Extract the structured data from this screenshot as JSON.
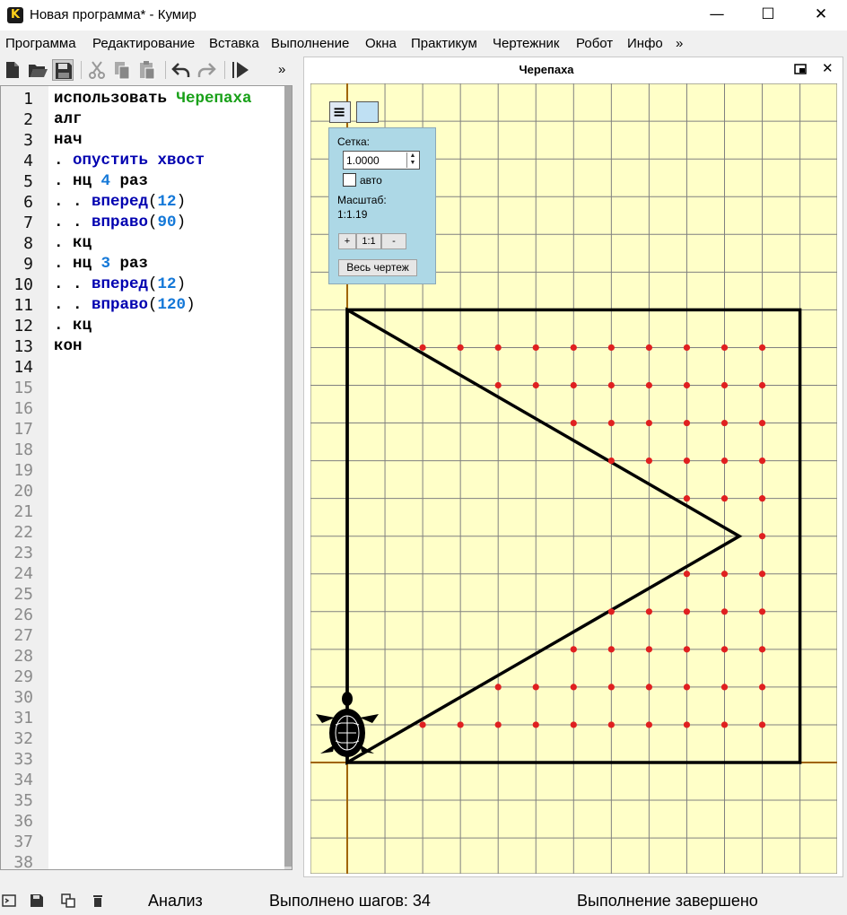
{
  "window": {
    "title": "Новая программа* - Кумир",
    "icon_letter": "K",
    "minimize": "—",
    "maximize": "☐",
    "close": "✕"
  },
  "menu": [
    "Программа",
    "Редактирование",
    "Вставка",
    "Выполнение",
    "Окна",
    "Практикум",
    "Чертежник",
    "Робот",
    "Инфо",
    "»"
  ],
  "toolbar": {
    "overflow": "»",
    "icons": [
      "new-file-icon",
      "open-folder-icon",
      "save-icon",
      "cut-icon",
      "copy-icon",
      "paste-icon",
      "undo-icon",
      "redo-icon",
      "run-icon"
    ]
  },
  "editor": {
    "line_numbers": [
      "1",
      "2",
      "3",
      "4",
      "5",
      "6",
      "7",
      "8",
      "9",
      "10",
      "11",
      "12",
      "13",
      "14",
      "15",
      "16",
      "17",
      "18",
      "19",
      "20",
      "21",
      "22",
      "23",
      "24",
      "25",
      "26",
      "27",
      "28",
      "29",
      "30",
      "31",
      "32",
      "33",
      "34",
      "35",
      "36",
      "37",
      "38"
    ],
    "lines": [
      [
        {
          "t": "использовать ",
          "c": "k"
        },
        {
          "t": "Черепаха",
          "c": "g"
        }
      ],
      [
        {
          "t": "алг",
          "c": "k"
        }
      ],
      [
        {
          "t": "нач",
          "c": "k"
        }
      ],
      [
        {
          "t": ". ",
          "c": "k"
        },
        {
          "t": "опустить хвост",
          "c": "b"
        }
      ],
      [
        {
          "t": ". нц ",
          "c": "k"
        },
        {
          "t": "4",
          "c": "n"
        },
        {
          "t": " раз",
          "c": "k"
        }
      ],
      [
        {
          "t": ". . ",
          "c": "k"
        },
        {
          "t": "вперед",
          "c": "b"
        },
        {
          "t": "(",
          "c": "p"
        },
        {
          "t": "12",
          "c": "n"
        },
        {
          "t": ")",
          "c": "p"
        }
      ],
      [
        {
          "t": ". . ",
          "c": "k"
        },
        {
          "t": "вправо",
          "c": "b"
        },
        {
          "t": "(",
          "c": "p"
        },
        {
          "t": "90",
          "c": "n"
        },
        {
          "t": ")",
          "c": "p"
        }
      ],
      [
        {
          "t": ". кц",
          "c": "k"
        }
      ],
      [
        {
          "t": ". нц ",
          "c": "k"
        },
        {
          "t": "3",
          "c": "n"
        },
        {
          "t": " раз",
          "c": "k"
        }
      ],
      [
        {
          "t": ". . ",
          "c": "k"
        },
        {
          "t": "вперед",
          "c": "b"
        },
        {
          "t": "(",
          "c": "p"
        },
        {
          "t": "12",
          "c": "n"
        },
        {
          "t": ")",
          "c": "p"
        }
      ],
      [
        {
          "t": ". . ",
          "c": "k"
        },
        {
          "t": "вправо",
          "c": "b"
        },
        {
          "t": "(",
          "c": "p"
        },
        {
          "t": "120",
          "c": "n"
        },
        {
          "t": ")",
          "c": "p"
        }
      ],
      [
        {
          "t": ". кц",
          "c": "k"
        }
      ],
      [
        {
          "t": "кон",
          "c": "k"
        }
      ]
    ]
  },
  "turtle_panel": {
    "title": "Черепаха",
    "close": "✕",
    "settings": {
      "grid_label": "Сетка:",
      "grid_value": "1.0000",
      "auto_label": "авто",
      "auto_checked": false,
      "scale_label": "Масштаб:",
      "scale_value": "1:1.19",
      "zoom_in": "+",
      "zoom_reset": "1:1",
      "zoom_out": "-",
      "fit_all": "Весь чертеж"
    },
    "colors": {
      "background": "#ffffc8",
      "grid": "#808080",
      "axis": "#a06400",
      "line": "#000000",
      "point": "#e02020"
    }
  },
  "status": {
    "analysis": "Анализ",
    "steps": "Выполнено шагов: 34",
    "state": "Выполнение завершено"
  }
}
